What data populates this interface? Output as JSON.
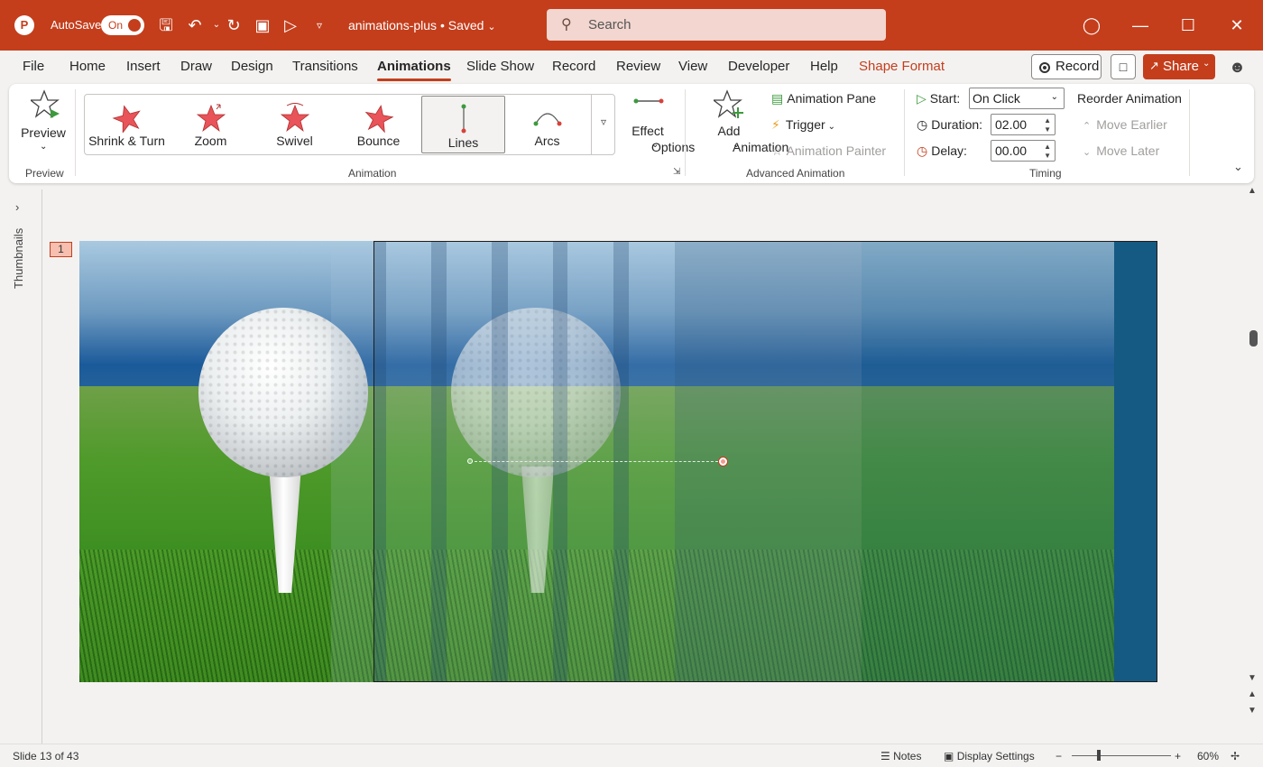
{
  "titlebar": {
    "autosave_label": "AutoSave",
    "autosave_state": "On",
    "doc_title": "animations-plus • Saved",
    "search_placeholder": "Search"
  },
  "menu": {
    "items": [
      "File",
      "Home",
      "Insert",
      "Draw",
      "Design",
      "Transitions",
      "Animations",
      "Slide Show",
      "Record",
      "Review",
      "View",
      "Developer",
      "Help",
      "Shape Format"
    ],
    "active": "Animations",
    "record_label": "Record",
    "share_label": "Share"
  },
  "ribbon": {
    "preview_label": "Preview",
    "preview_group": "Preview",
    "gallery": [
      {
        "label": "Shrink & Turn"
      },
      {
        "label": "Zoom"
      },
      {
        "label": "Swivel"
      },
      {
        "label": "Bounce"
      },
      {
        "label": "Lines"
      },
      {
        "label": "Arcs"
      }
    ],
    "gallery_selected": "Lines",
    "effect_options_line1": "Effect",
    "effect_options_line2": "Options",
    "animation_group": "Animation",
    "add_animation_line1": "Add",
    "add_animation_line2": "Animation",
    "animation_pane": "Animation Pane",
    "trigger": "Trigger",
    "animation_painter": "Animation Painter",
    "advanced_group": "Advanced Animation",
    "start_label": "Start:",
    "start_value": "On Click",
    "duration_label": "Duration:",
    "duration_value": "02.00",
    "delay_label": "Delay:",
    "delay_value": "00.00",
    "timing_group": "Timing",
    "reorder_label": "Reorder Animation",
    "move_earlier": "Move Earlier",
    "move_later": "Move Later"
  },
  "workspace": {
    "thumbnails_label": "Thumbnails",
    "slide_number": "1"
  },
  "status": {
    "slide_info": "Slide 13 of 43",
    "notes": "Notes",
    "display_settings": "Display Settings",
    "zoom": "60%"
  },
  "colors": {
    "accent": "#c43e1c",
    "star_fill": "#e8545a"
  }
}
